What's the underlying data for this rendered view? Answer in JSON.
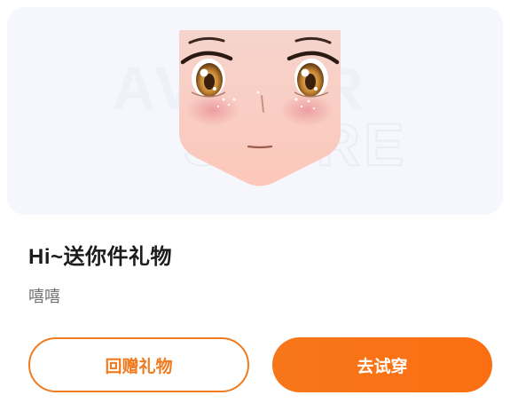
{
  "preview": {
    "image_alt": "anime avatar face preview",
    "watermark_lines": [
      "AVATAR",
      "STORE"
    ]
  },
  "gift": {
    "title": "Hi~送你件礼物",
    "message": "嘻嘻"
  },
  "actions": {
    "return_gift_label": "回赠礼物",
    "try_on_label": "去试穿"
  },
  "colors": {
    "accent": "#f97316",
    "preview_bg": "#f5f7fc",
    "title_text": "#1c1c1c",
    "body_text": "#6f6f6f"
  }
}
